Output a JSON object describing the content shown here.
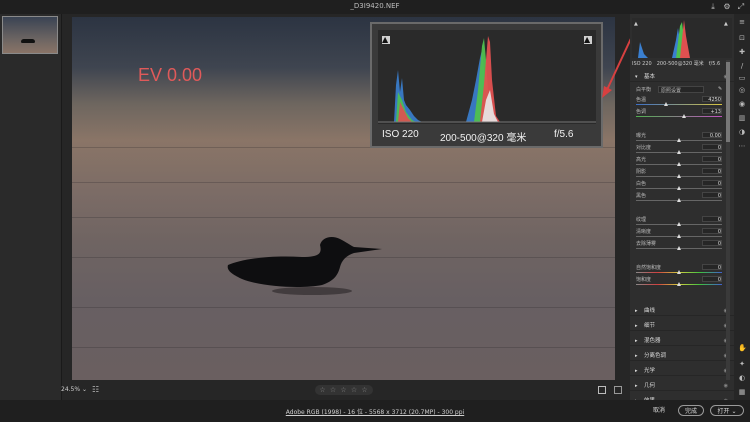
{
  "window": {
    "title": "_D3I9420.NEF"
  },
  "filmstrip": {
    "thumbnail_alt": ""
  },
  "overlay": {
    "ev_label": "EV 0.00",
    "iso": "ISO 220",
    "lens": "200-500@320 毫米",
    "aperture": "f/5.6"
  },
  "right_panel": {
    "mini_info": {
      "iso": "ISO 220",
      "lens": "200-500@320 毫米",
      "aperture": "f/5.6"
    },
    "basic_header": "基本",
    "white_balance": {
      "label": "白平衡",
      "value": "原照设置"
    },
    "sliders": [
      {
        "label": "色温",
        "value": "4250",
        "pos": 0.35,
        "kind": "temp"
      },
      {
        "label": "色调",
        "value": "+13",
        "pos": 0.56,
        "kind": "tint"
      },
      {
        "label": "曝光",
        "value": "0.00",
        "pos": 0.5,
        "kind": "plain"
      },
      {
        "label": "对比度",
        "value": "0",
        "pos": 0.5,
        "kind": "plain"
      },
      {
        "label": "高光",
        "value": "0",
        "pos": 0.5,
        "kind": "plain"
      },
      {
        "label": "阴影",
        "value": "0",
        "pos": 0.5,
        "kind": "plain"
      },
      {
        "label": "白色",
        "value": "0",
        "pos": 0.5,
        "kind": "plain"
      },
      {
        "label": "黑色",
        "value": "0",
        "pos": 0.5,
        "kind": "plain"
      },
      {
        "label": "纹理",
        "value": "0",
        "pos": 0.5,
        "kind": "plain"
      },
      {
        "label": "清晰度",
        "value": "0",
        "pos": 0.5,
        "kind": "plain"
      },
      {
        "label": "去除薄雾",
        "value": "0",
        "pos": 0.5,
        "kind": "plain"
      },
      {
        "label": "自然饱和度",
        "value": "0",
        "pos": 0.5,
        "kind": "sat"
      },
      {
        "label": "饱和度",
        "value": "0",
        "pos": 0.5,
        "kind": "sat"
      }
    ],
    "collapsed_sections": [
      "曲线",
      "细节",
      "混色器",
      "分离色调",
      "光学",
      "几何",
      "效果"
    ]
  },
  "toolbar": {
    "zoom": "24.5%",
    "stars": "☆ ☆ ☆ ☆ ☆"
  },
  "status": {
    "file_info": "Adobe RGB (1998) - 16 位 - 5568 x 3712 (20.7MP) - 300 ppi",
    "cancel_label": "取消",
    "done_label": "完成",
    "open_label": "打开"
  },
  "colors": {
    "annotation": "#e05a5a",
    "panel_bg": "#2e2e2e"
  }
}
